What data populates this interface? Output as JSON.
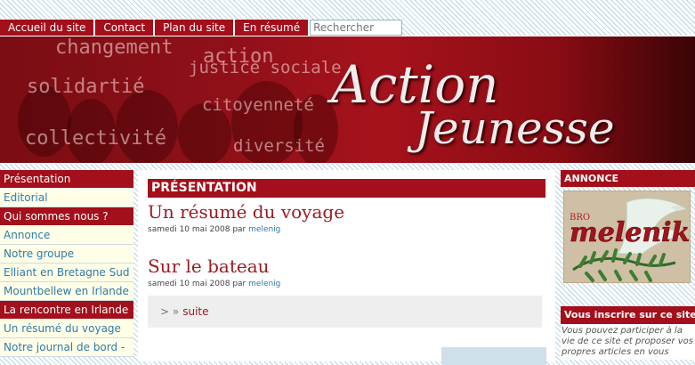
{
  "nav": {
    "items": [
      "Accueil du site",
      "Contact",
      "Plan du site",
      "En résumé"
    ],
    "search_placeholder": "Rechercher"
  },
  "banner": {
    "logo_line1": "Action",
    "logo_line2": "Jeunesse",
    "words": [
      "changement",
      "action",
      "justice sociale",
      "solidartié",
      "citoyenneté",
      "collectivité",
      "diversité"
    ]
  },
  "sidebar": {
    "items": [
      {
        "label": "Présentation",
        "type": "head"
      },
      {
        "label": "Editorial",
        "type": "link"
      },
      {
        "label": "Qui sommes nous ?",
        "type": "head"
      },
      {
        "label": "Annonce",
        "type": "link"
      },
      {
        "label": "Notre groupe",
        "type": "link"
      },
      {
        "label": "Elliant en Bretagne Sud",
        "type": "link"
      },
      {
        "label": "Mountbellew en Irlande",
        "type": "link"
      },
      {
        "label": "La rencontre en Irlande",
        "type": "head"
      },
      {
        "label": "Un résumé du voyage",
        "type": "link"
      },
      {
        "label": "Notre journal de bord -",
        "type": "link"
      }
    ]
  },
  "main": {
    "section_title": "PRÉSENTATION",
    "articles": [
      {
        "title": "Un résumé du voyage",
        "date": "samedi 10 mai 2008",
        "by": "par",
        "author": "melenig"
      },
      {
        "title": "Sur le bateau",
        "date": "samedi 10 mai 2008",
        "by": "par",
        "author": "melenig"
      }
    ],
    "more_label": "suite",
    "more_chevrons": "> »"
  },
  "right": {
    "annonce_title": "ANNONCE",
    "annonce_image_text": "melenik",
    "annonce_image_small": "BRO",
    "inscrire_title": "Vous inscrire sur ce site",
    "inscrire_text": "Vous pouvez participer à la vie de ce site et proposer vos propres articles en vous"
  },
  "colors": {
    "brand_red": "#a30f1a",
    "link_blue": "#2f7ba7",
    "title_red": "#9e1a22",
    "sidebar_bg": "#ffffe8"
  }
}
